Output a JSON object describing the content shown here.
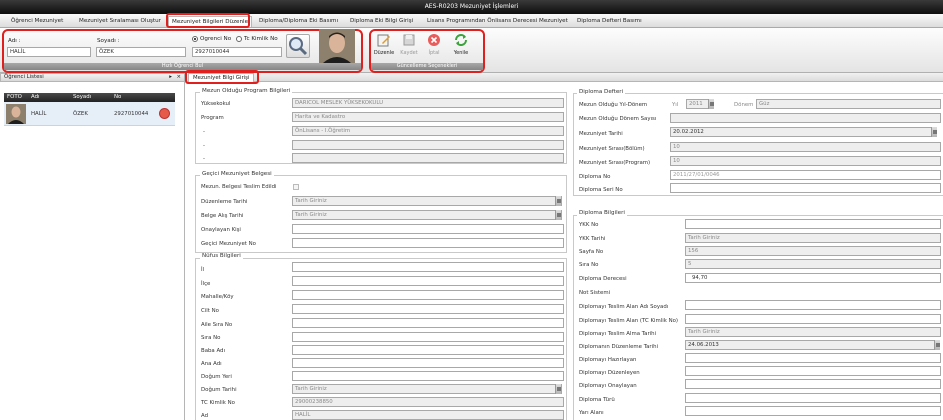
{
  "app": {
    "title": "AES-R0203 Mezuniyet İşlemleri"
  },
  "menu": {
    "items": [
      {
        "label": "Öğrenci Mezuniyet"
      },
      {
        "label": "Mezuniyet Sıralaması Oluştur"
      },
      {
        "label": "Mezuniyet Bilgileri Düzenle"
      },
      {
        "label": "Diploma/Diploma Eki Basımı"
      },
      {
        "label": "Diploma Eki Bilgi Girişi"
      },
      {
        "label": "Lisans Programından Önlisans Derecesi Mezuniyet"
      },
      {
        "label": "Diploma Defteri Basımı"
      }
    ]
  },
  "search": {
    "ad_label": "Adı :",
    "ad_value": "HALİL",
    "soyadi_label": "Soyadı :",
    "soyadi_value": "ÖZEK",
    "radio_ogrenci_no": "Ogrenci No",
    "radio_tc_kimlik": "Tc Kimlik No",
    "number_value": "2927010044",
    "group_title": "Hızlı Öğrenci Bul"
  },
  "actions": {
    "duzenle": "Düzenle",
    "kaydet": "Kaydet",
    "iptal": "İptal",
    "yenile": "Yenile",
    "group_title": "Güncelleme Seçenekleri"
  },
  "student_list": {
    "title": "Öğrenci Listesi",
    "columns": [
      "FOTO",
      "Adı",
      "Soyadı",
      "No"
    ],
    "rows": [
      {
        "ad": "HALİL",
        "soyad": "ÖZEK",
        "no": "2927010044"
      }
    ]
  },
  "tab": {
    "label": "Mezuniyet Bilgi Girişi"
  },
  "program_section": {
    "legend": "Mezun Olduğu Program Bilgileri",
    "yuksekokul_label": "Yüksekokul",
    "yuksekokul_value": "DARICOL MESLEK YÜKSEKOKULU",
    "program_label": "Program",
    "program_value": "Harita ve Kadastro",
    "dash1": "-",
    "dash1_value": "ÖnLisans - I.Öğretim",
    "dash2": "-",
    "dash3": "-"
  },
  "gecici_section": {
    "legend": "Geçici Mezuniyet Belgesi",
    "teslim_label": "Mezun. Belgesi Teslim Edildi",
    "duzenleme_label": "Düzenleme Tarihi",
    "duzenleme_placeholder": "Tarih Giriniz",
    "alis_label": "Belge Alış Tarihi",
    "alis_placeholder": "Tarih Giriniz",
    "onaylayan_label": "Onaylayan Kişi",
    "gecici_no_label": "Geçici Mezuniyet No"
  },
  "nufus_section": {
    "legend": "Nüfus Bilgileri",
    "fields": [
      "İl",
      "İlçe",
      "Mahalle/Köy",
      "Cilt No",
      "Aile Sıra No",
      "Sıra No",
      "Baba Adı",
      "Ana Adı",
      "Doğum Yeri",
      "Doğum Tarihi",
      "TC Kimlik No",
      "Ad"
    ],
    "dogum_tarihi_placeholder": "Tarih Giriniz",
    "tc_value": "29000238850",
    "ad_value": "HALİL"
  },
  "defter_section": {
    "legend": "Diploma Defteri",
    "yil_donem_label": "Mezun Olduğu Yıl-Dönem",
    "yil_prefix": "Yıl",
    "yil_value": "2011",
    "donem_label": "Dönem",
    "donem_value": "Güz",
    "donem_sayisi_label": "Mezun Olduğu Dönem Sayısı",
    "tarih_label": "Mezuniyet Tarihi",
    "tarih_value": "20.02.2012",
    "sira_bolum_label": "Mezuniyet Sırası(Bölüm)",
    "sira_bolum_value": "10",
    "sira_program_label": "Mezuniyet Sırası(Program)",
    "sira_program_value": "10",
    "diploma_no_label": "Diploma No",
    "diploma_no_value": "2011/27/01/0046",
    "seri_no_label": "Diploma Seri No"
  },
  "diploma_section": {
    "legend": "Diploma Bilgileri",
    "ykk_no_label": "YKK No",
    "ykk_tarih_label": "YKK Tarihi",
    "ykk_tarih_placeholder": "Tarih Giriniz",
    "sayfa_label": "Sayfa No",
    "sayfa_value": "156",
    "sira_label": "Sıra No",
    "sira_value": "5",
    "derece_label": "Diploma Derecesi",
    "derece_value": "94,70",
    "not_label": "Not Sistemi",
    "teslim_alan_label": "Diplomayı Teslim Alan Adı Soyadı",
    "teslim_tc_label": "Diplomayı Teslim Alan (TC Kimlik No)",
    "teslim_tarih_label": "Diplomayı Teslim Alma Tarihi",
    "teslim_tarih_placeholder": "Tarih Giriniz",
    "duzenleme_tarih_label": "Diplomanın Düzenleme Tarihi",
    "duzenleme_tarih_value": "24.06.2013",
    "hazirlayan_label": "Diplomayı Hazırlayan",
    "duzenleyen_label": "Diplomayı Düzenleyen",
    "onaylayan_label": "Diplomayı Onaylayan",
    "turu_label": "Diploma Türü",
    "yari_alan_label": "Yarı Alanı"
  }
}
